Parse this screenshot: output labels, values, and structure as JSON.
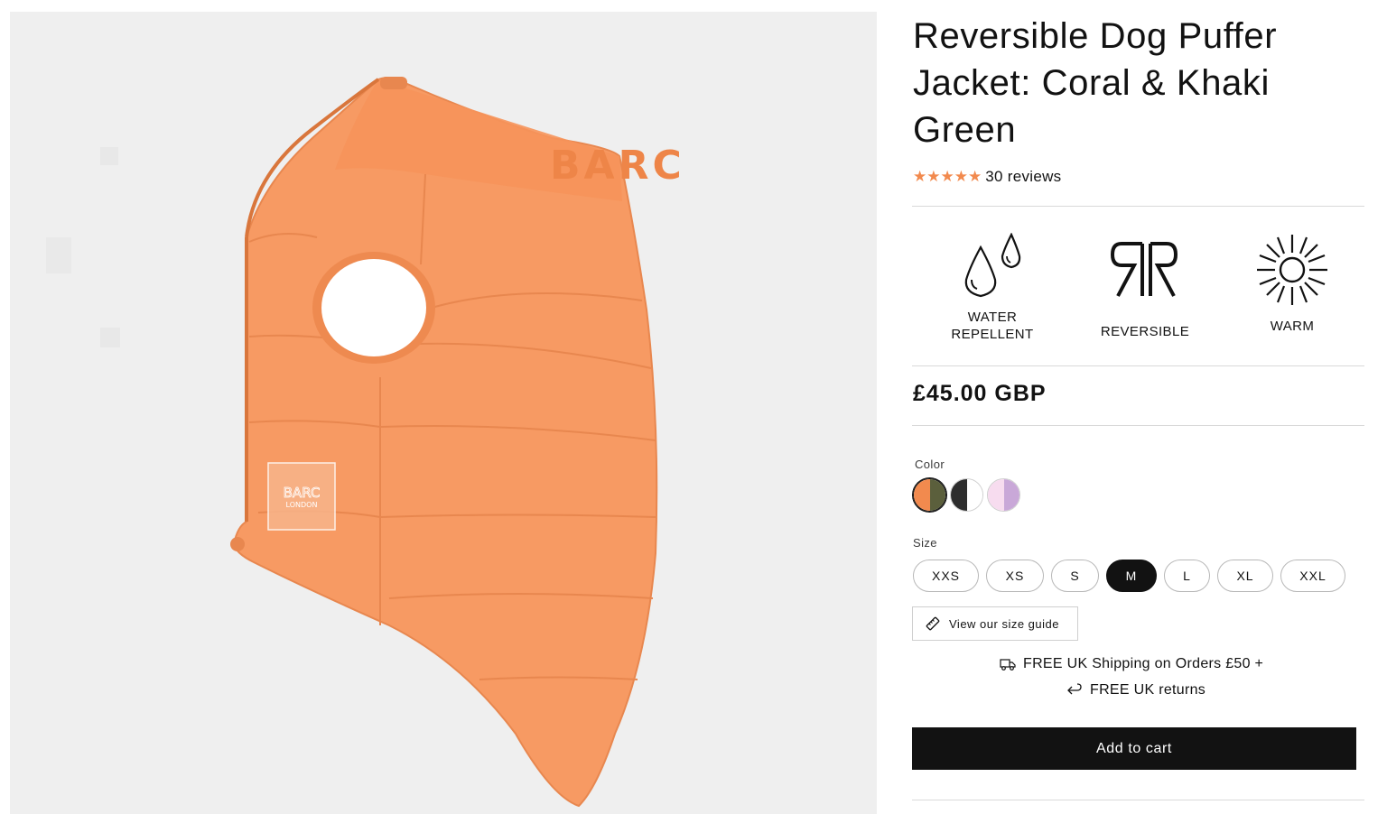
{
  "product": {
    "title": "Reversible Dog Puffer Jacket: Coral & Khaki Green",
    "rating": {
      "stars": "★★★★★",
      "value": 5,
      "reviews_label": "30 reviews"
    },
    "price": "£45.00 GBP"
  },
  "image": {
    "brand_text": "BARC",
    "label_text_1": "BARC",
    "label_text_2": "LONDON",
    "background_color": "#efefef",
    "jacket_color": "#f79a63"
  },
  "features": [
    {
      "icon": "water-drops-icon",
      "label_line1": "WATER",
      "label_line2": "REPELLENT"
    },
    {
      "icon": "reversible-icon",
      "label_line1": "REVERSIBLE",
      "label_line2": ""
    },
    {
      "icon": "sun-icon",
      "label_line1": "WARM",
      "label_line2": ""
    }
  ],
  "color": {
    "label": "Color",
    "swatches": [
      {
        "name": "coral-khaki",
        "left": "#f28a4e",
        "right": "#5b5f3c",
        "selected": true
      },
      {
        "name": "black-white",
        "left": "#2d2d2d",
        "right": "#ffffff",
        "selected": false
      },
      {
        "name": "pink-lilac",
        "left": "#f7dcef",
        "right": "#c9a8d8",
        "selected": false
      }
    ]
  },
  "size": {
    "label": "Size",
    "options": [
      "XXS",
      "XS",
      "S",
      "M",
      "L",
      "XL",
      "XXL"
    ],
    "selected": "M"
  },
  "size_guide": {
    "label": "View our size guide",
    "icon": "ruler-icon"
  },
  "perks": {
    "shipping": {
      "icon": "truck-icon",
      "label": "FREE UK Shipping on Orders £50 +"
    },
    "returns": {
      "icon": "return-arrow-icon",
      "label": "FREE UK returns"
    }
  },
  "cart": {
    "label": "Add to cart"
  }
}
